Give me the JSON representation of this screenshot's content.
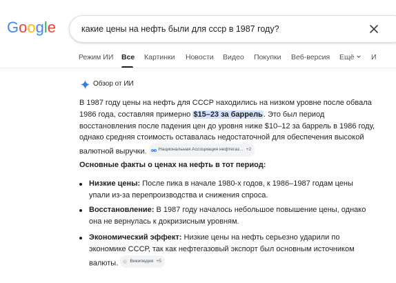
{
  "logo": {
    "text": "Google",
    "letters": [
      {
        "ch": "G",
        "color": "#4285F4"
      },
      {
        "ch": "o",
        "color": "#EA4335"
      },
      {
        "ch": "o",
        "color": "#FBBC05"
      },
      {
        "ch": "g",
        "color": "#4285F4"
      },
      {
        "ch": "l",
        "color": "#34A853"
      },
      {
        "ch": "e",
        "color": "#EA4335"
      }
    ]
  },
  "search": {
    "query": "какие цены на нефть были для ссср в 1987 году?",
    "clear_icon": "close-icon"
  },
  "tabs": [
    {
      "label": "Режим ИИ"
    },
    {
      "label": "Все"
    },
    {
      "label": "Картинки"
    },
    {
      "label": "Новости"
    },
    {
      "label": "Видео"
    },
    {
      "label": "Покупки"
    },
    {
      "label": "Веб-версия"
    },
    {
      "label": "Ещё"
    },
    {
      "label": "И"
    }
  ],
  "ai_overview": {
    "title": "Обзор от ИИ",
    "icon": "sparkle-icon",
    "accent": "#4285F4",
    "para_p1": "В 1987 году цены на нефть для СССР находились на низком уровне после обвала 1986 года, составляя примерно ",
    "para_highlight": "$15–23 за баррель",
    "para_p2": ". Это был период восстановления после падения цен до уровня ниже $10–12 за баррель в 1986 году, однако средняя стоимость оставалась недостаточной для обеспечения высокой валютной выручки.",
    "source1": {
      "label": "Национальная Ассоциация нефтегаз...",
      "more": "+2"
    },
    "facts_heading": "Основные факты о ценах на нефть в тот период:",
    "bullets": [
      {
        "bold": "Низкие цены:",
        "text": " После пика в начале 1980-х годов, к 1986–1987 годам цены упали из-за перепроизводства и снижения спроса."
      },
      {
        "bold": "Восстановление:",
        "text": " В 1987 году началось небольшое повышение цены, однако она не вернулась к докризисным уровням."
      },
      {
        "bold": "Экономический эффект:",
        "text": " Низкие цены на нефть серьезно ударили по экономике СССР, так как нефтегазовый экспорт был основным источником валюты."
      }
    ],
    "source2": {
      "label": "Википедия",
      "more": "+5"
    }
  }
}
